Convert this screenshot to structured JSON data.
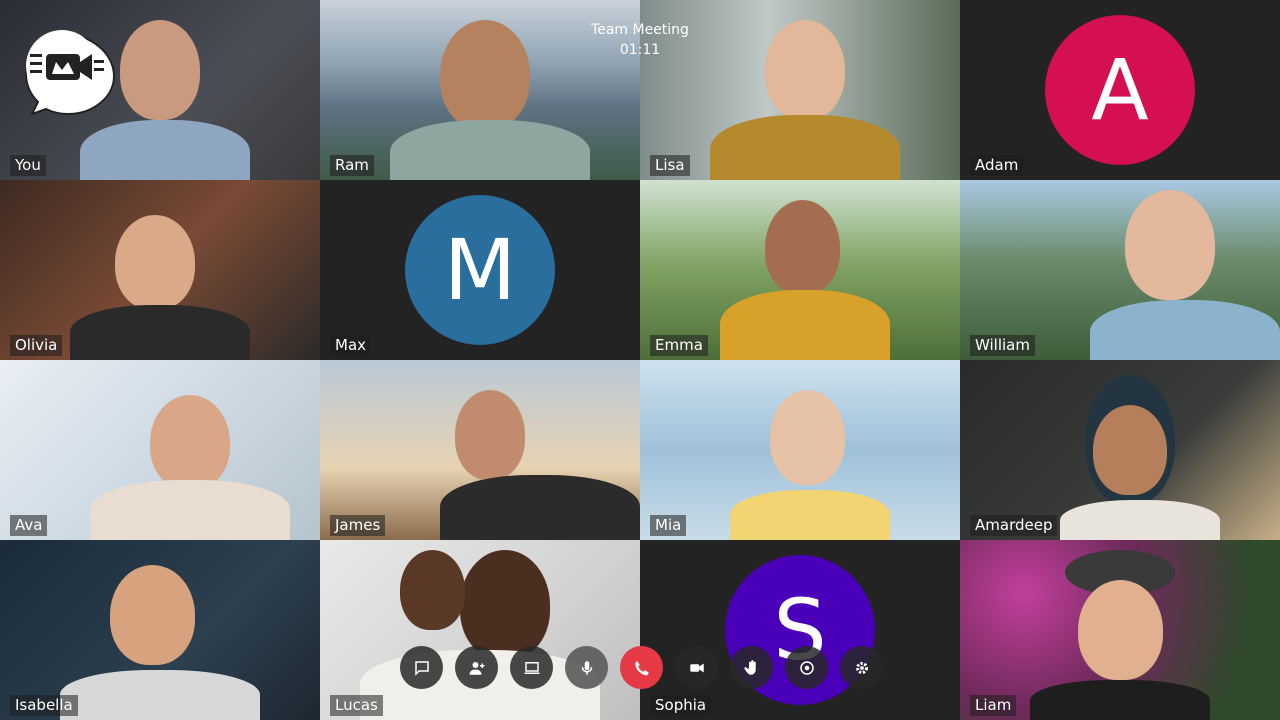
{
  "meeting": {
    "title": "Team Meeting",
    "time": "01:11"
  },
  "participants": [
    {
      "name": "You"
    },
    {
      "name": "Ram"
    },
    {
      "name": "Lisa"
    },
    {
      "name": "Adam",
      "initial": "A",
      "color": "#d40f52"
    },
    {
      "name": "Olivia"
    },
    {
      "name": "Max",
      "initial": "M",
      "color": "#2a6e9e"
    },
    {
      "name": "Emma"
    },
    {
      "name": "William"
    },
    {
      "name": "Ava"
    },
    {
      "name": "James"
    },
    {
      "name": "Mia"
    },
    {
      "name": "Amardeep"
    },
    {
      "name": "Isabella"
    },
    {
      "name": "Lucas"
    },
    {
      "name": "Sophia",
      "initial": "S",
      "color": "#4a00b8"
    },
    {
      "name": "Liam"
    }
  ],
  "controls": [
    {
      "icon": "chat-icon"
    },
    {
      "icon": "add-participant-icon"
    },
    {
      "icon": "screen-share-icon"
    },
    {
      "icon": "microphone-icon"
    },
    {
      "icon": "end-call-icon",
      "color": "#e53946"
    },
    {
      "icon": "camera-icon"
    },
    {
      "icon": "raise-hand-icon"
    },
    {
      "icon": "record-icon"
    },
    {
      "icon": "settings-icon"
    }
  ]
}
